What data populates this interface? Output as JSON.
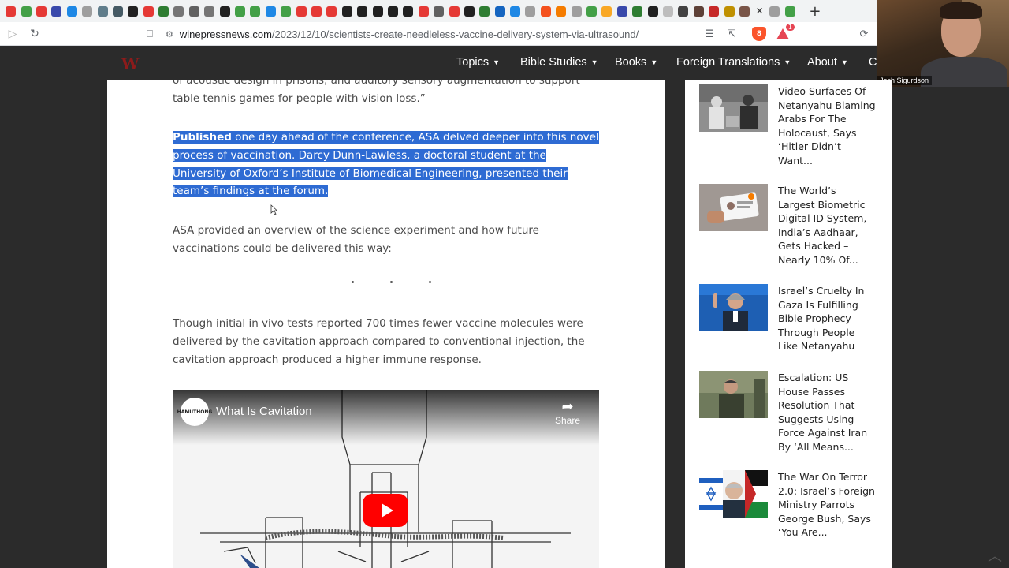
{
  "browser": {
    "url_host": "winepressnews.com",
    "url_path": "/2023/12/10/scientists-create-needleless-vaccine-delivery-system-via-ultrasound/",
    "rewards_badge": "1",
    "shields_badge": "8"
  },
  "tab_favicon_colors": [
    "#e53935",
    "#43a047",
    "#e53935",
    "#3949ab",
    "#1e88e5",
    "#9e9e9e",
    "#607d8b",
    "#455a64",
    "#212121",
    "#e53935",
    "#2e7d32",
    "#757575",
    "#616161",
    "#757575",
    "#212121",
    "#43a047",
    "#43a047",
    "#1e88e5",
    "#43a047",
    "#e53935",
    "#e53935",
    "#e53935",
    "#212121",
    "#212121",
    "#212121",
    "#212121",
    "#212121",
    "#e53935",
    "#616161",
    "#e53935",
    "#212121",
    "#2e7d32",
    "#1565c0",
    "#1e88e5",
    "#9e9e9e",
    "#f4511e",
    "#f57c00",
    "#9e9e9e",
    "#43a047",
    "#f9a825",
    "#3949ab",
    "#2e7d32",
    "#212121",
    "#bdbdbd",
    "#424242",
    "#5d4037",
    "#c62828",
    "#bf9000",
    "#795548",
    "#9e9e9e",
    "#43a047"
  ],
  "webcam": {
    "name": "Josh Sigurdson"
  },
  "nav": {
    "items": [
      {
        "label": "Topics"
      },
      {
        "label": "Bible Studies"
      },
      {
        "label": "Books"
      },
      {
        "label": "Foreign Translations"
      },
      {
        "label": "About"
      }
    ],
    "search_partial": "C"
  },
  "article": {
    "para_top": "of acoustic design in prisons, and auditory sensory augmentation to support table tennis games for people with vision loss.”",
    "pub_bold": "Published",
    "pub_rest": " one day ahead of the conference, ASA delved deeper into this novel process of vaccination. Darcy Dunn-Lawless, a doctoral student at the University of Oxford’s Institute of Biomedical Engineering, presented their team’s findings at the forum.",
    "para_asa": "ASA provided an overview of the science experiment and how future vaccinations could be delivered this way:",
    "para_though": "Though initial in vivo tests reported 700 times fewer vaccine molecules were delivered by the cavitation approach compared to conventional injection, the cavitation approach produced a higher immune response.",
    "video": {
      "title": "What Is Cavitation",
      "share_label": "Share",
      "channel_text": "HAMUTHONG"
    }
  },
  "sidebar": {
    "items": [
      {
        "title": "Video Surfaces Of Netanyahu Blaming Arabs For The Holocaust, Says ‘Hitler Didn’t Want..."
      },
      {
        "title": "The World’s Largest Biometric Digital ID System, India’s Aadhaar, Gets Hacked – Nearly 10% Of..."
      },
      {
        "title": "Israel’s Cruelty In Gaza Is Fulfilling Bible Prophecy Through People Like Netanyahu"
      },
      {
        "title": "Escalation: US House Passes Resolution That Suggests Using Force Against Iran By ‘All Means..."
      },
      {
        "title": "The War On Terror 2.0: Israel’s Foreign Ministry Parrots George Bush, Says ‘You Are..."
      }
    ]
  }
}
